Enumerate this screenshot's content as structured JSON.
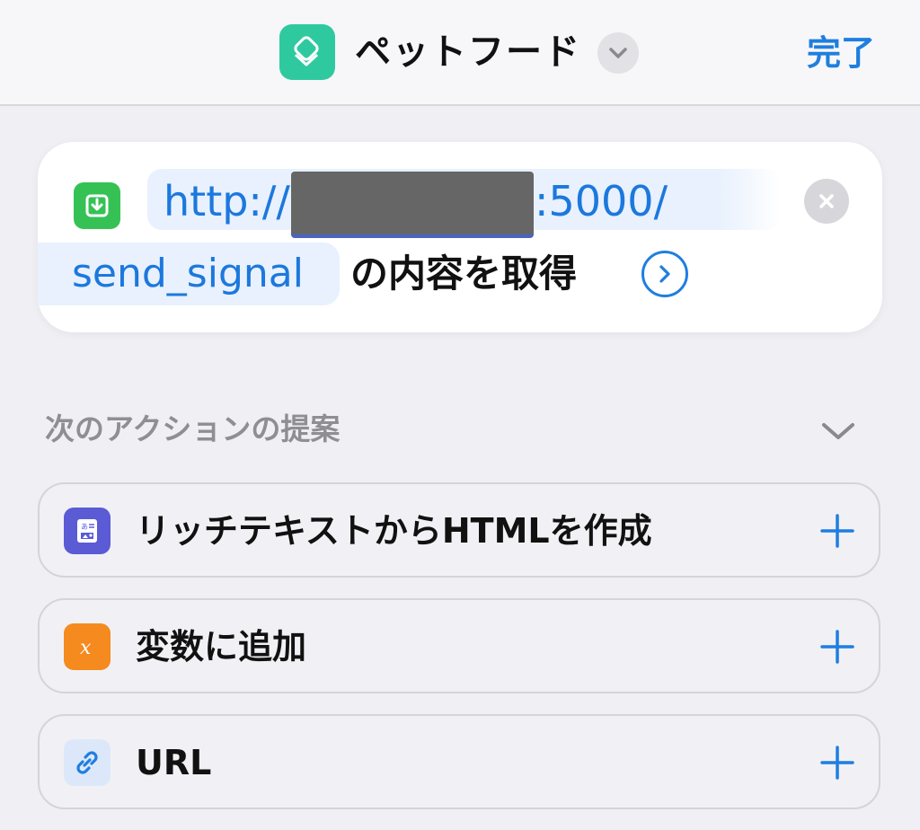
{
  "header": {
    "title": "ペットフード",
    "done_label": "完了"
  },
  "action": {
    "url_prefix": "http://",
    "url_suffix": ":5000/",
    "endpoint": "send_signal",
    "action_text": "の内容を取得"
  },
  "suggestions": {
    "title": "次のアクションの提案",
    "items": [
      {
        "label": "リッチテキストからHTMLを作成",
        "icon": "rich-text-html-icon",
        "color": "#5b5bd6"
      },
      {
        "label": "変数に追加",
        "icon": "variable-icon",
        "color": "#f58a1f"
      },
      {
        "label": "URL",
        "icon": "link-icon",
        "color": "#dce8fa"
      }
    ]
  },
  "colors": {
    "accent": "#1f7ee0",
    "app_icon": "#2fc9a0",
    "download_icon": "#36c155"
  }
}
